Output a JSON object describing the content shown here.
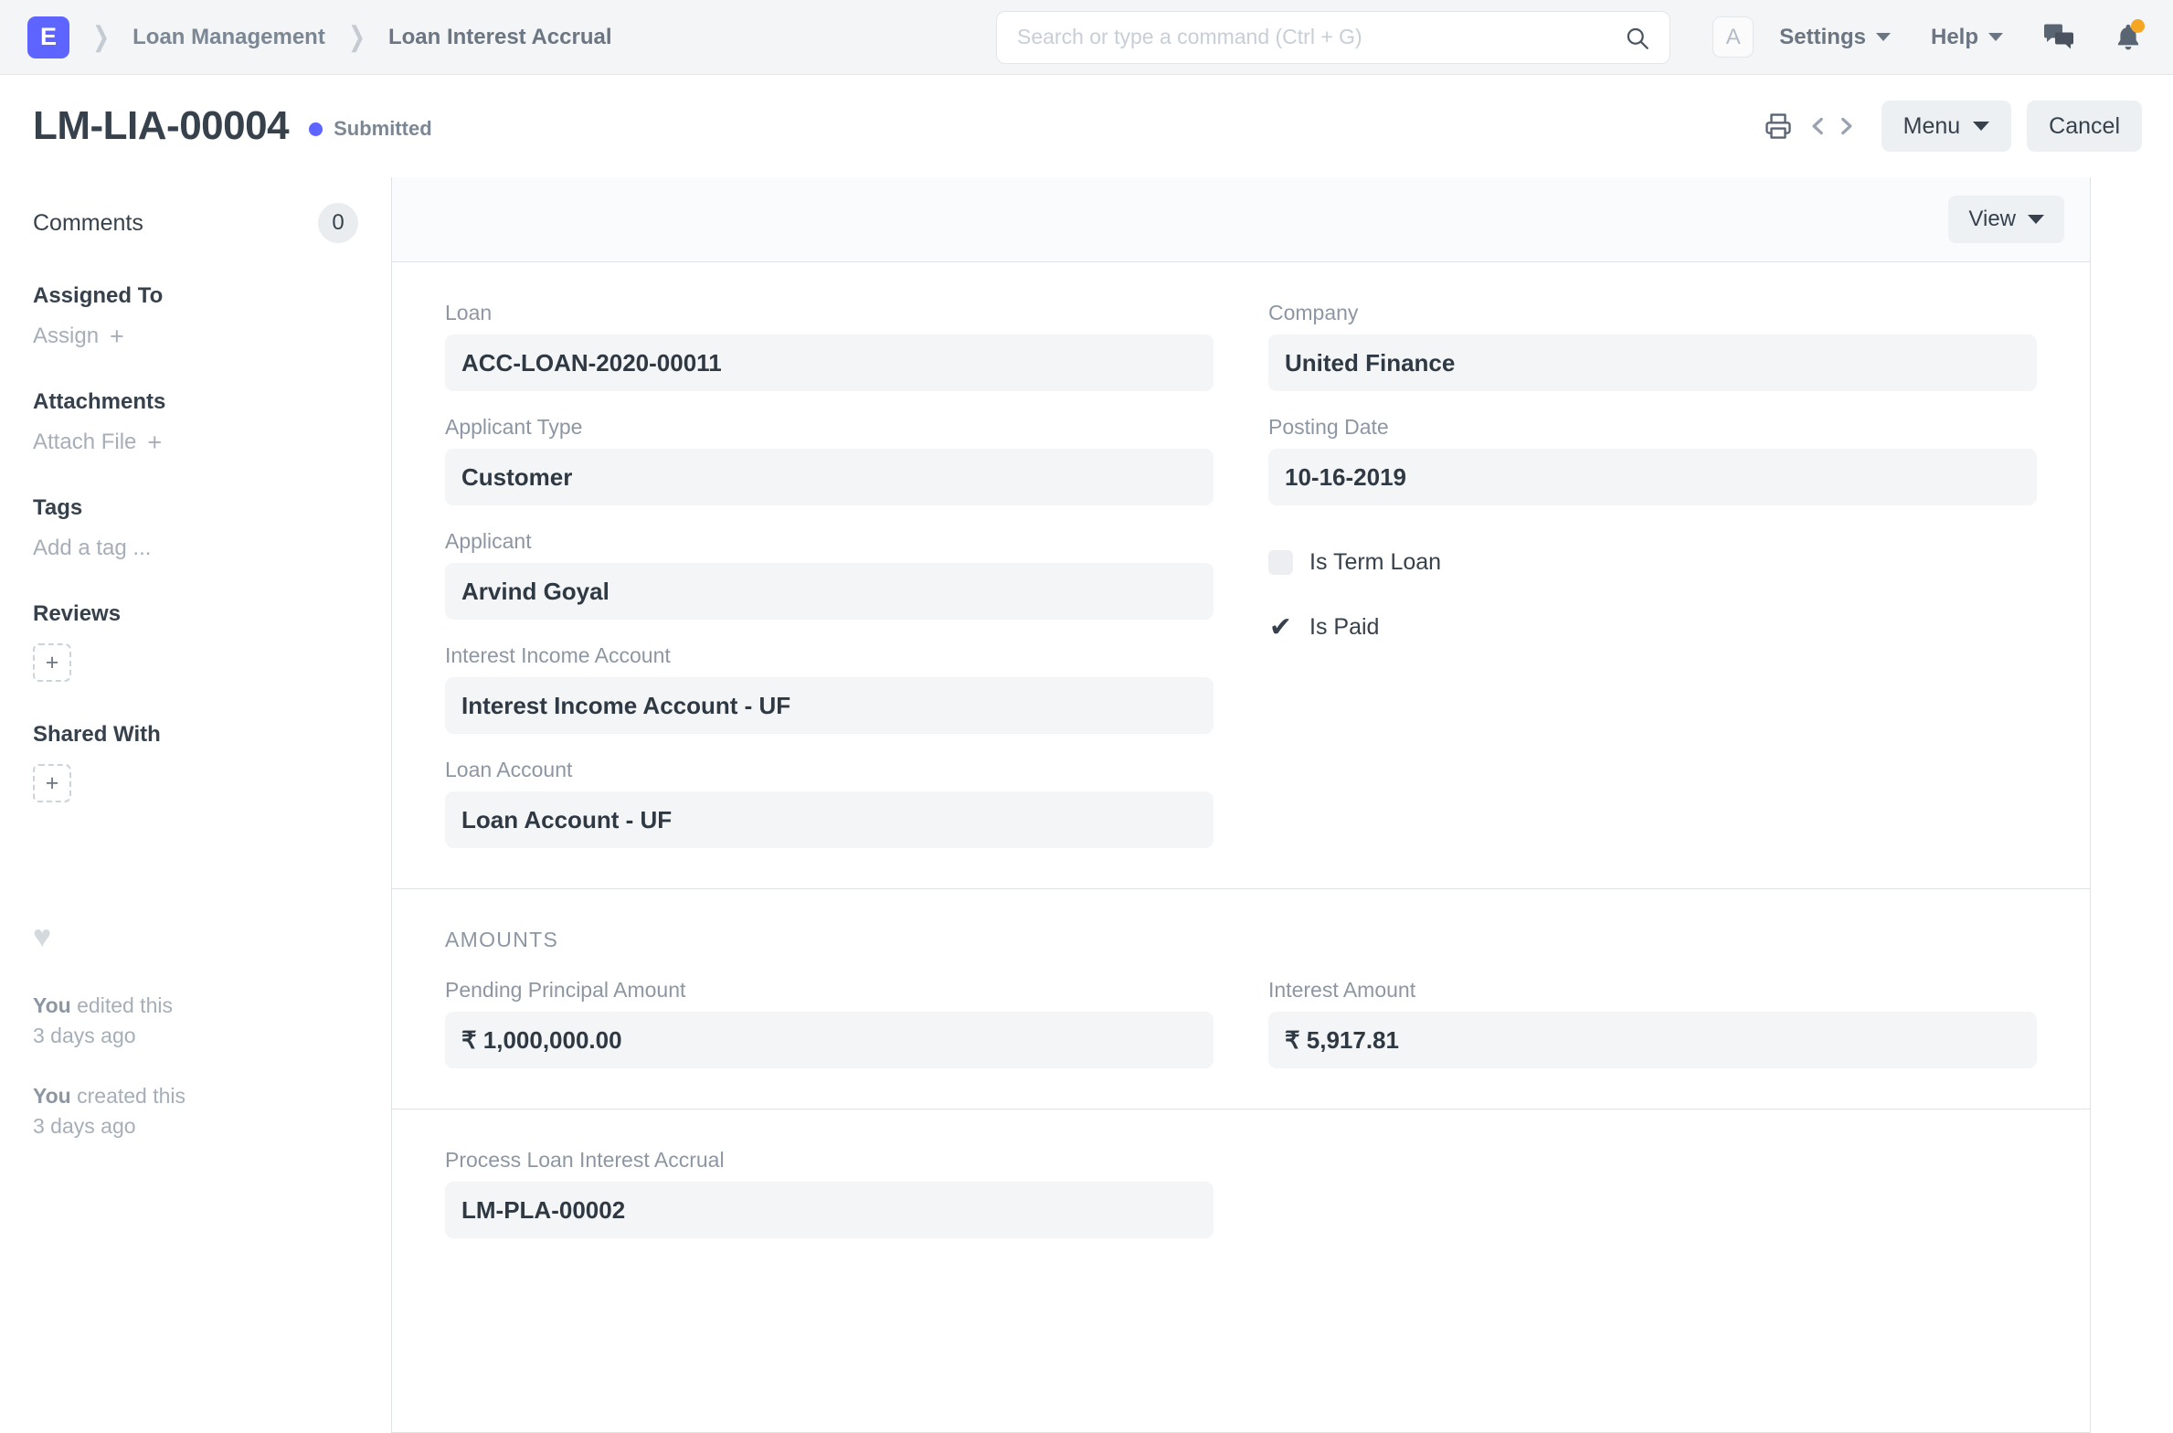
{
  "navbar": {
    "logo_letter": "E",
    "breadcrumb": [
      {
        "label": "Loan Management"
      },
      {
        "label": "Loan Interest Accrual"
      }
    ],
    "search": {
      "placeholder": "Search or type a command (Ctrl + G)",
      "value": ""
    },
    "avatar_letter": "A",
    "settings_label": "Settings",
    "help_label": "Help",
    "icons": {
      "search": "search-icon",
      "chat": "chat-icon",
      "bell": "bell-icon"
    }
  },
  "page_head": {
    "title": "LM-LIA-00004",
    "status": "Submitted",
    "status_color": "#5e64ff",
    "print_label": "Print",
    "prev_label": "Previous",
    "next_label": "Next",
    "menu_label": "Menu",
    "cancel_label": "Cancel"
  },
  "sidebar": {
    "comments_label": "Comments",
    "comments_count": "0",
    "assigned_to_label": "Assigned To",
    "assign_label": "Assign",
    "attachments_label": "Attachments",
    "attach_file_label": "Attach File",
    "tags_label": "Tags",
    "add_tag_label": "Add a tag ...",
    "reviews_label": "Reviews",
    "reviews_add": "+",
    "shared_with_label": "Shared With",
    "shared_add": "+",
    "plus_glyph": "+",
    "activity": [
      {
        "who": "You",
        "action": " edited this",
        "time": "3 days ago"
      },
      {
        "who": "You",
        "action": " created this",
        "time": "3 days ago"
      }
    ]
  },
  "main": {
    "view_label": "View",
    "sections": [
      {
        "label": "",
        "left_fields": [
          {
            "label": "Loan",
            "value": "ACC-LOAN-2020-00011"
          },
          {
            "label": "Applicant Type",
            "value": "Customer"
          },
          {
            "label": "Applicant",
            "value": "Arvind Goyal"
          },
          {
            "label": "Interest Income Account",
            "value": "Interest Income Account - UF"
          },
          {
            "label": "Loan Account",
            "value": "Loan Account - UF"
          }
        ],
        "right_fields": [
          {
            "label": "Company",
            "value": "United Finance"
          },
          {
            "label": "Posting Date",
            "value": "10-16-2019"
          }
        ],
        "right_checkboxes": [
          {
            "label": "Is Term Loan",
            "checked": false
          },
          {
            "label": "Is Paid",
            "checked": true
          }
        ]
      },
      {
        "label": "AMOUNTS",
        "left_fields": [
          {
            "label": "Pending Principal Amount",
            "value": "₹ 1,000,000.00"
          }
        ],
        "right_fields": [
          {
            "label": "Interest Amount",
            "value": "₹ 5,917.81"
          }
        ]
      },
      {
        "label": "",
        "left_fields": [
          {
            "label": "Process Loan Interest Accrual",
            "value": "LM-PLA-00002"
          }
        ],
        "right_fields": []
      }
    ]
  }
}
